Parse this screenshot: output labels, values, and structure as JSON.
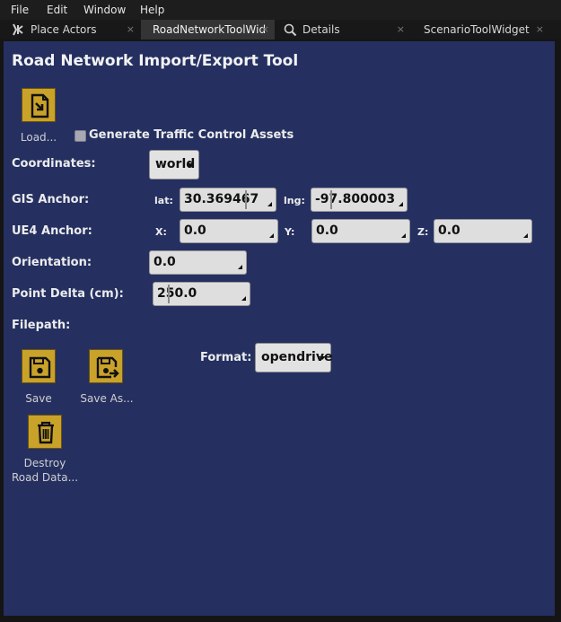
{
  "menu": {
    "items": [
      "File",
      "Edit",
      "Window",
      "Help"
    ]
  },
  "tabs": [
    {
      "label": "Place Actors",
      "icon": "place-actors-icon"
    },
    {
      "label": "RoadNetworkToolWid",
      "active": true
    },
    {
      "label": "Details",
      "icon": "search-icon"
    },
    {
      "label": "ScenarioToolWidget"
    }
  ],
  "tool": {
    "title": "Road Network Import/Export Tool",
    "load_label": "Load...",
    "generate_traffic_label": "Generate Traffic Control Assets",
    "generate_traffic_checked": false,
    "coordinates_label": "Coordinates:",
    "coordinates_value": "world",
    "gis_anchor_label": "GIS Anchor:",
    "lat_label": "lat:",
    "lat_value": "30.369467",
    "lng_label": "lng:",
    "lng_value": "-97.800003",
    "ue4_anchor_label": "UE4 Anchor:",
    "x_label": "X:",
    "x_value": "0.0",
    "y_label": "Y:",
    "y_value": "0.0",
    "z_label": "Z:",
    "z_value": "0.0",
    "orientation_label": "Orientation:",
    "orientation_value": "0.0",
    "point_delta_label": "Point Delta (cm):",
    "point_delta_value": "250.0",
    "filepath_label": "Filepath:",
    "format_label": "Format:",
    "format_value": "opendrive",
    "save_label": "Save",
    "save_as_label": "Save As...",
    "destroy_label_line1": "Destroy",
    "destroy_label_line2": "Road Data..."
  },
  "colors": {
    "panel_bg": "#253061",
    "button_yellow": "#c9a22a",
    "field_bg": "#dedede"
  }
}
